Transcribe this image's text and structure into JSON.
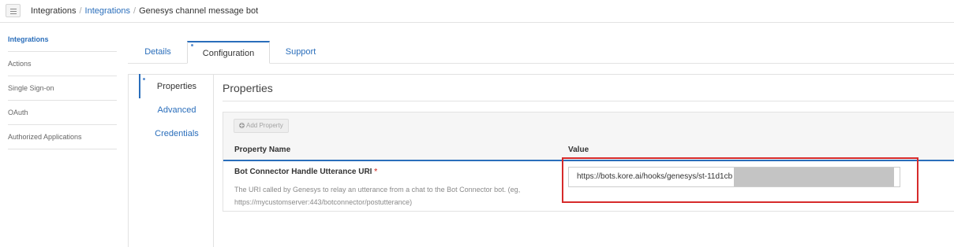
{
  "breadcrumb": {
    "root": "Integrations",
    "link": "Integrations",
    "current": "Genesys channel message bot",
    "separator": "/"
  },
  "sidebar": {
    "items": [
      {
        "label": "Integrations",
        "active": true
      },
      {
        "label": "Actions",
        "active": false
      },
      {
        "label": "Single Sign-on",
        "active": false
      },
      {
        "label": "OAuth",
        "active": false
      },
      {
        "label": "Authorized Applications",
        "active": false
      }
    ]
  },
  "tabs": [
    {
      "label": "Details",
      "active": false
    },
    {
      "label": "Configuration",
      "active": true
    },
    {
      "label": "Support",
      "active": false
    }
  ],
  "inner_nav": {
    "items": [
      {
        "label": "Properties",
        "active": true
      },
      {
        "label": "Advanced",
        "active": false
      },
      {
        "label": "Credentials",
        "active": false
      }
    ]
  },
  "properties": {
    "title": "Properties",
    "add_button_label": "Add Property",
    "columns": {
      "name": "Property Name",
      "value": "Value"
    },
    "rows": [
      {
        "name": "Bot Connector Handle Utterance URI",
        "required_marker": "*",
        "description": "The URI called by Genesys to relay an utterance from a chat to the Bot Connector bot. (eg, https://mycustomserver:443/botconnector/postutterance)",
        "value": "https://bots.kore.ai/hooks/genesys/st-11d1cb"
      }
    ]
  },
  "colors": {
    "accent": "#2a6ebb",
    "highlight_border": "#d62b2b",
    "required": "#d9534f",
    "redaction": "#c4c4c4"
  }
}
